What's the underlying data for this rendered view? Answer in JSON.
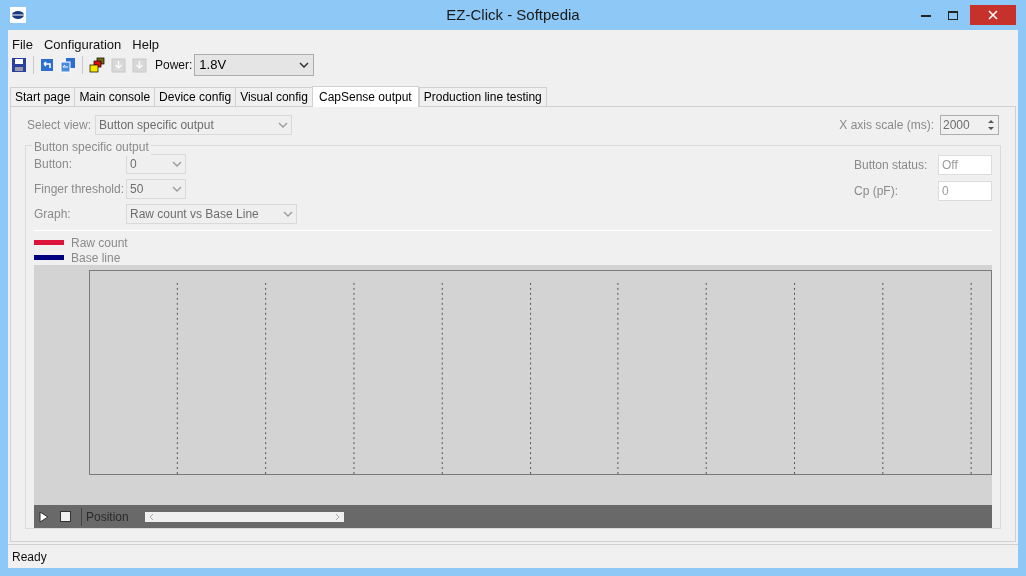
{
  "window": {
    "title": "EZ-Click - Softpedia"
  },
  "menu": [
    "File",
    "Configuration",
    "Help"
  ],
  "toolbar": {
    "buttons": [
      {
        "kind": "save",
        "disabled": false
      },
      {
        "kind": "back",
        "disabled": false
      },
      {
        "kind": "back-all",
        "disabled": false
      },
      {
        "kind": "colors",
        "disabled": false
      },
      {
        "kind": "down",
        "disabled": true
      },
      {
        "kind": "down",
        "disabled": true
      }
    ],
    "power_label": "Power:",
    "power_value": "1.8V"
  },
  "tabs": [
    {
      "label": "Start page",
      "selected": false
    },
    {
      "label": "Main console",
      "selected": false
    },
    {
      "label": "Device config",
      "selected": false
    },
    {
      "label": "Visual config",
      "selected": false
    },
    {
      "label": "CapSense output",
      "selected": true
    },
    {
      "label": "Production line testing",
      "selected": false
    }
  ],
  "select_view": {
    "label": "Select view:",
    "value": "Button specific output"
  },
  "x_axis_scale": {
    "label": "X axis scale (ms):",
    "value": "2000"
  },
  "group": {
    "title": "Button specific output",
    "fields": [
      {
        "label": "Button:",
        "value": "0",
        "kind": "small"
      },
      {
        "label": "Finger threshold:",
        "value": "50",
        "kind": "small"
      },
      {
        "label": "Graph:",
        "value": "Raw count vs Base Line",
        "kind": "wide"
      }
    ],
    "status": [
      {
        "label": "Button status:",
        "value": "Off"
      },
      {
        "label": "Cp (pF):",
        "value": "0"
      }
    ]
  },
  "legend": [
    {
      "label": "Raw count",
      "color": "#dc143c"
    },
    {
      "label": "Base line",
      "color": "#000080"
    }
  ],
  "player": {
    "position_label": "Position"
  },
  "status_bar": "Ready"
}
